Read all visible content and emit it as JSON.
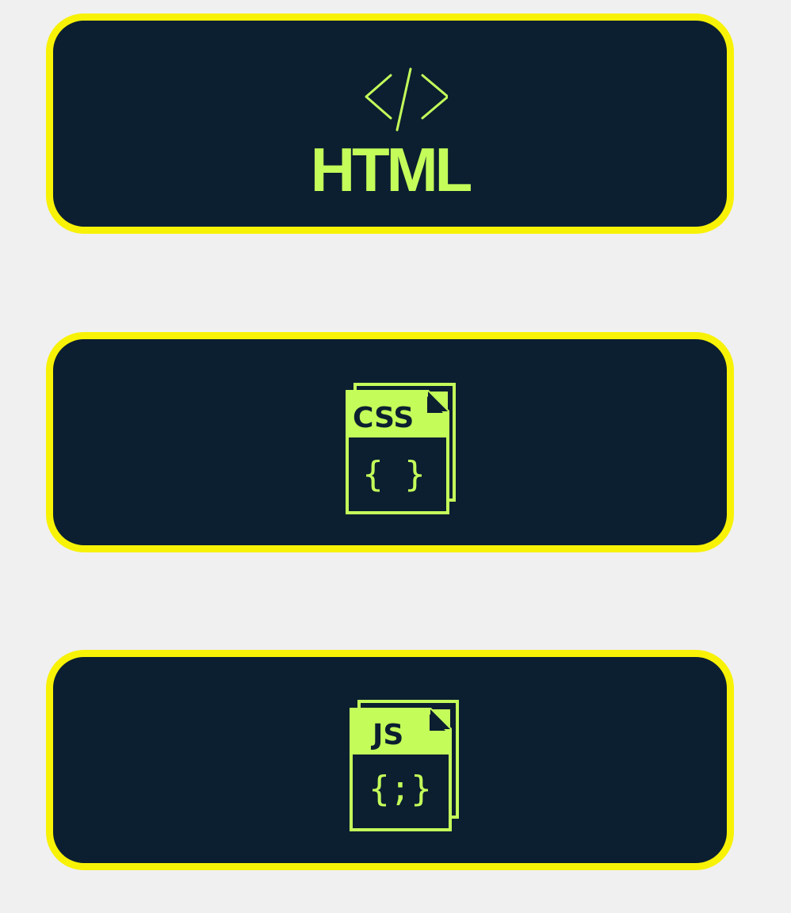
{
  "cards": [
    {
      "label": "HTML",
      "icon": "code-brackets-icon"
    },
    {
      "label": "CSS",
      "body": "{ }",
      "icon": "css-file-icon"
    },
    {
      "label": "JS",
      "body": "{;}",
      "icon": "js-file-icon"
    }
  ],
  "colors": {
    "page_background": "#f0f0f0",
    "card_background": "#0b1f30",
    "card_border": "#f8f206",
    "accent": "#c4fd5a"
  }
}
